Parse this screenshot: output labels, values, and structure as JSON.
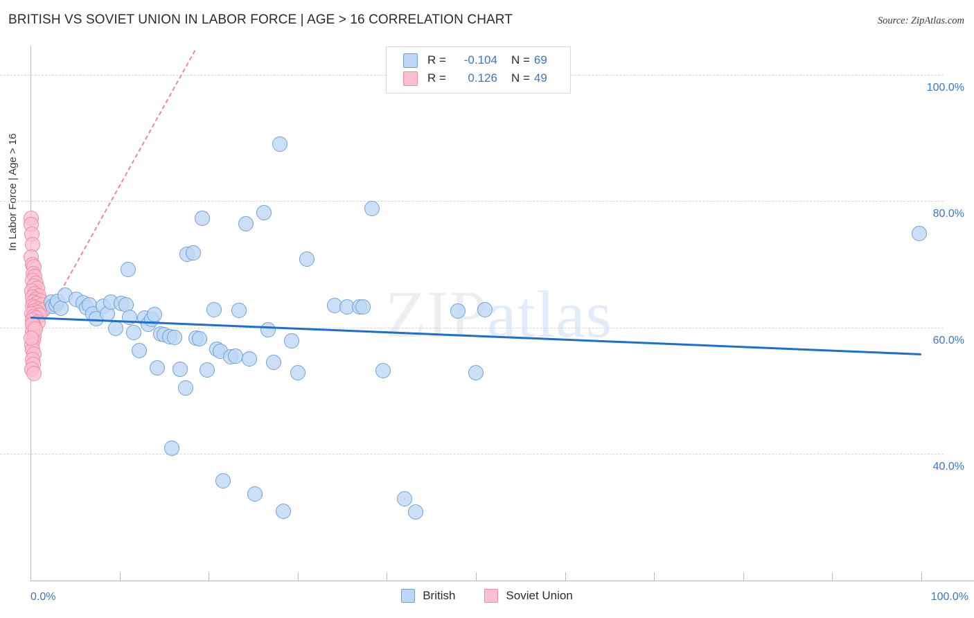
{
  "header": {
    "title": "BRITISH VS SOVIET UNION IN LABOR FORCE | AGE > 16 CORRELATION CHART",
    "source": "Source: ZipAtlas.com"
  },
  "watermark": {
    "part1": "ZIP",
    "part2": "atlas"
  },
  "stats_legend": {
    "rows": [
      {
        "r_label": "R =",
        "r_value": "-0.104",
        "n_label": "N =",
        "n_value": "69",
        "color": "#bcd7f5"
      },
      {
        "r_label": "R =",
        "r_value": "0.126",
        "n_label": "N =",
        "n_value": "49",
        "color": "#fbc0d0"
      }
    ]
  },
  "series_legend": [
    {
      "label": "British",
      "color": "#bcd7f5"
    },
    {
      "label": "Soviet Union",
      "color": "#fbc0d0"
    }
  ],
  "chart_data": {
    "type": "scatter",
    "title": "BRITISH VS SOVIET UNION IN LABOR FORCE | AGE > 16 CORRELATION CHART",
    "xlabel": "",
    "ylabel": "In Labor Force | Age > 16",
    "xlim": [
      0,
      100
    ],
    "ylim": [
      20,
      104.6
    ],
    "grid": true,
    "x_tick_labels": [
      "0.0%",
      "100.0%"
    ],
    "y_tick_labels": [
      "100.0%",
      "80.0%",
      "60.0%",
      "40.0%"
    ],
    "y_ticks": [
      100,
      80,
      60,
      40
    ],
    "x_ticks": [
      0,
      10,
      20,
      30,
      40,
      50,
      60,
      70,
      80,
      90,
      100
    ],
    "legend_position": "bottom-center",
    "series": [
      {
        "name": "British",
        "color": "#bcd7f5",
        "edge_color": "#6f9fd8",
        "r": -0.104,
        "n": 69,
        "trendline": {
          "x0": 0,
          "y0": 61.8,
          "x1": 100,
          "y1": 56.0
        },
        "points": [
          [
            2.3,
            64.0
          ],
          [
            2.5,
            63.4
          ],
          [
            2.9,
            63.6
          ],
          [
            3.0,
            64.2
          ],
          [
            3.4,
            63.1
          ],
          [
            3.9,
            65.2
          ],
          [
            5.1,
            64.5
          ],
          [
            5.9,
            63.9
          ],
          [
            6.3,
            63.2
          ],
          [
            6.6,
            63.6
          ],
          [
            7.0,
            62.2
          ],
          [
            7.4,
            61.4
          ],
          [
            8.2,
            63.4
          ],
          [
            8.6,
            62.2
          ],
          [
            9.0,
            64.0
          ],
          [
            9.6,
            59.9
          ],
          [
            10.2,
            63.8
          ],
          [
            10.7,
            63.6
          ],
          [
            11.0,
            69.2
          ],
          [
            11.1,
            61.6
          ],
          [
            11.6,
            59.2
          ],
          [
            12.2,
            56.4
          ],
          [
            12.8,
            61.5
          ],
          [
            13.2,
            60.6
          ],
          [
            13.6,
            61.3
          ],
          [
            13.9,
            62.1
          ],
          [
            14.2,
            53.6
          ],
          [
            14.6,
            59.0
          ],
          [
            15.0,
            58.9
          ],
          [
            15.6,
            58.6
          ],
          [
            15.9,
            40.9
          ],
          [
            16.2,
            58.5
          ],
          [
            16.8,
            53.4
          ],
          [
            17.4,
            50.5
          ],
          [
            17.6,
            71.6
          ],
          [
            18.3,
            71.8
          ],
          [
            18.6,
            58.4
          ],
          [
            19.0,
            58.3
          ],
          [
            19.3,
            77.3
          ],
          [
            19.8,
            53.3
          ],
          [
            20.6,
            62.9
          ],
          [
            20.9,
            56.6
          ],
          [
            21.3,
            56.3
          ],
          [
            21.6,
            35.8
          ],
          [
            22.5,
            55.4
          ],
          [
            23.0,
            55.5
          ],
          [
            23.4,
            62.7
          ],
          [
            24.2,
            76.4
          ],
          [
            24.6,
            55.1
          ],
          [
            25.2,
            33.7
          ],
          [
            26.2,
            78.2
          ],
          [
            26.7,
            59.7
          ],
          [
            27.3,
            54.5
          ],
          [
            28.0,
            89.0
          ],
          [
            28.4,
            31.0
          ],
          [
            29.3,
            57.9
          ],
          [
            30.0,
            52.9
          ],
          [
            31.0,
            70.9
          ],
          [
            34.1,
            63.5
          ],
          [
            35.5,
            63.3
          ],
          [
            36.9,
            63.3
          ],
          [
            37.3,
            63.3
          ],
          [
            38.3,
            78.9
          ],
          [
            39.6,
            53.2
          ],
          [
            42.0,
            32.9
          ],
          [
            43.2,
            30.8
          ],
          [
            48.0,
            62.6
          ],
          [
            51.0,
            62.9
          ],
          [
            50.0,
            52.9
          ],
          [
            99.8,
            74.9
          ]
        ]
      },
      {
        "name": "Soviet Union",
        "color": "#fbc0d0",
        "edge_color": "#f08aa8",
        "r": 0.126,
        "n": 49,
        "trendline": {
          "x0": 1.5,
          "y0": 61.0,
          "x1": 18.5,
          "y1": 104.0
        },
        "points": [
          [
            0.1,
            77.3
          ],
          [
            0.1,
            76.3
          ],
          [
            0.15,
            74.8
          ],
          [
            0.2,
            73.2
          ],
          [
            0.1,
            71.2
          ],
          [
            0.25,
            70.0
          ],
          [
            0.4,
            69.6
          ],
          [
            0.3,
            68.6
          ],
          [
            0.5,
            68.1
          ],
          [
            0.2,
            67.5
          ],
          [
            0.6,
            67.0
          ],
          [
            0.35,
            66.6
          ],
          [
            0.8,
            66.2
          ],
          [
            0.15,
            65.8
          ],
          [
            0.45,
            65.4
          ],
          [
            0.9,
            65.0
          ],
          [
            0.25,
            64.8
          ],
          [
            0.6,
            64.5
          ],
          [
            1.1,
            64.3
          ],
          [
            0.3,
            64.0
          ],
          [
            0.7,
            63.8
          ],
          [
            1.3,
            63.6
          ],
          [
            0.2,
            63.4
          ],
          [
            0.5,
            63.2
          ],
          [
            0.95,
            63.0
          ],
          [
            1.5,
            62.8
          ],
          [
            0.35,
            62.6
          ],
          [
            0.75,
            62.4
          ],
          [
            0.15,
            62.2
          ],
          [
            1.0,
            62.0
          ],
          [
            0.4,
            61.8
          ],
          [
            0.6,
            61.5
          ],
          [
            0.25,
            61.2
          ],
          [
            0.85,
            60.9
          ],
          [
            0.3,
            60.5
          ],
          [
            0.5,
            60.0
          ],
          [
            0.2,
            59.4
          ],
          [
            0.4,
            58.7
          ],
          [
            0.3,
            58.0
          ],
          [
            0.15,
            57.3
          ],
          [
            0.25,
            56.5
          ],
          [
            0.35,
            55.8
          ],
          [
            0.2,
            55.0
          ],
          [
            0.3,
            54.2
          ],
          [
            0.15,
            53.4
          ],
          [
            0.4,
            52.8
          ],
          [
            0.2,
            60.6
          ],
          [
            0.55,
            59.8
          ],
          [
            0.1,
            58.4
          ]
        ]
      }
    ]
  }
}
